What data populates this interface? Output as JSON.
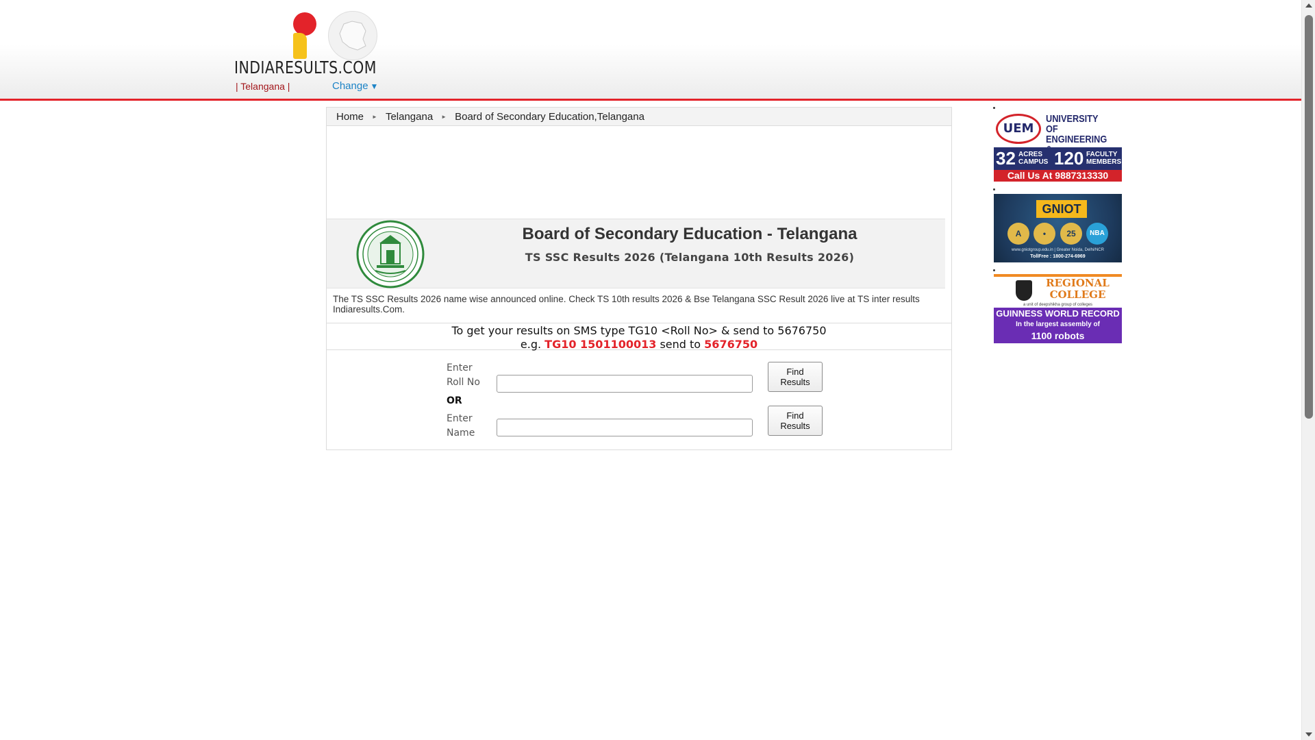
{
  "site": {
    "logo_text": "INDIARESULTS.COM",
    "state_label": "| Telangana  |",
    "change_label": "Change",
    "change_caret": "▼"
  },
  "breadcrumb": {
    "items": [
      "Home",
      "Telangana",
      "Board of Secondary Education,Telangana"
    ]
  },
  "board": {
    "title": "Board of Secondary Education - Telangana",
    "subtitle": "TS SSC Results 2026 (Telangana 10th Results 2026)"
  },
  "description": "The TS SSC Results 2026 name wise announced online. Check TS 10th results 2026 & Bse Telangana SSC Result 2026 live at TS inter results Indiaresults.Com.",
  "sms": {
    "line1": "To get your results on SMS type TG10 <Roll No> & send to 5676750",
    "eg_prefix": "e.g. ",
    "eg_code": "TG10 1501100013",
    "eg_middle": " send to ",
    "eg_number": "5676750"
  },
  "form": {
    "roll_label_1": "Enter",
    "roll_label_2": "Roll No",
    "or_label": "OR",
    "name_label_1": "Enter",
    "name_label_2": "Name",
    "roll_value": "",
    "name_value": "",
    "find_label_1": "Find",
    "find_label_2": "Results"
  },
  "ads": {
    "uem": {
      "logo": "UEM",
      "name": "UNIVERSITY OF ENGINEERING & MANAGEMENT",
      "stat1_big": "32",
      "stat1_small": "ACRES CAMPUS",
      "stat2_big": "120",
      "stat2_small": "FACULTY MEMBERS",
      "call": "Call Us At 9887313330"
    },
    "gniot": {
      "brand": "GNIOT",
      "badges": [
        "A",
        "•",
        "25",
        "NBA"
      ],
      "fine": "www.gniotgroup.edu.in | Greater Noida, Delhi/NCR",
      "toll": "TollFree : 1800-274-6969"
    },
    "regional": {
      "name": "REGIONAL COLLEGE",
      "tag": "a unit of deepshikha group of colleges",
      "line1": "GUINNESS WORLD RECORD",
      "line2": "In the largest assembly of",
      "line3": "1100 robots"
    }
  },
  "colors": {
    "accent_red": "#e3232a",
    "link_blue": "#1c83c6",
    "emblem_green": "#2f8a3c"
  }
}
